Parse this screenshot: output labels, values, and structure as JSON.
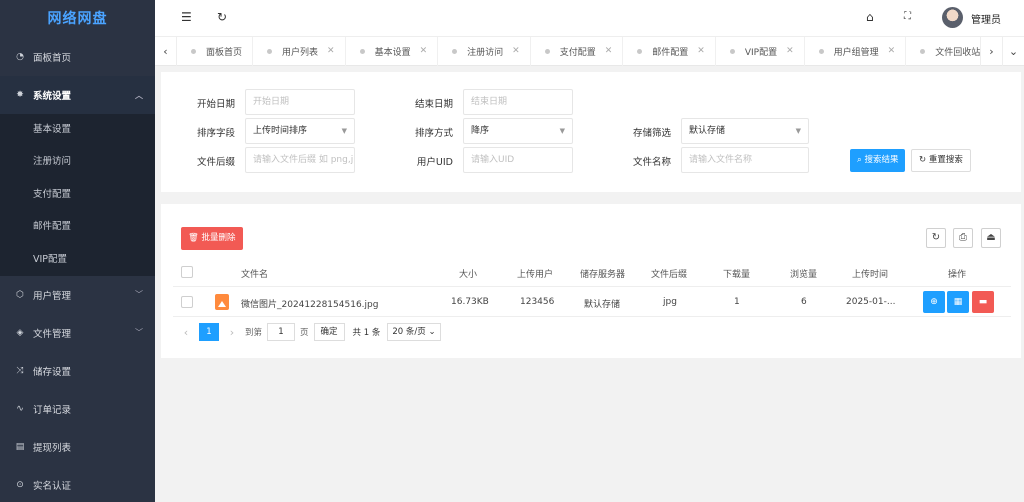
{
  "app": {
    "logo": "网络网盘"
  },
  "sidebar": {
    "items": [
      {
        "label": "面板首页",
        "icon": "dashboard-icon"
      },
      {
        "label": "系统设置",
        "icon": "gear-icon",
        "expanded": true
      },
      {
        "label": "用户管理",
        "icon": "box-icon"
      },
      {
        "label": "文件管理",
        "icon": "layers-icon"
      },
      {
        "label": "储存设置",
        "icon": "shuffle-icon"
      },
      {
        "label": "订单记录",
        "icon": "pulse-icon"
      },
      {
        "label": "提现列表",
        "icon": "list-icon"
      },
      {
        "label": "实名认证",
        "icon": "check-circle-icon"
      }
    ],
    "sub": [
      "基本设置",
      "注册访问",
      "支付配置",
      "邮件配置",
      "VIP配置"
    ]
  },
  "header": {
    "admin": "管理员"
  },
  "tabs": [
    "面板首页",
    "用户列表",
    "基本设置",
    "注册访问",
    "支付配置",
    "邮件配置",
    "VIP配置",
    "用户组管理",
    "文件回收站"
  ],
  "search": {
    "start_date_label": "开始日期",
    "start_date_placeholder": "开始日期",
    "end_date_label": "结束日期",
    "end_date_placeholder": "结束日期",
    "sort_field_label": "排序字段",
    "sort_field_value": "上传时间排序",
    "sort_order_label": "排序方式",
    "sort_order_value": "降序",
    "storage_label": "存储筛选",
    "storage_value": "默认存储",
    "suffix_label": "文件后缀",
    "suffix_placeholder": "请输入文件后缀 如 png,jpg 等",
    "uid_label": "用户UID",
    "uid_placeholder": "请输入UID",
    "name_label": "文件名称",
    "name_placeholder": "请输入文件名称",
    "search_btn": "搜索结果",
    "reset_btn": "重置搜索"
  },
  "table": {
    "batch_delete": "批量删除",
    "columns": [
      "文件名",
      "大小",
      "上传用户",
      "储存服务器",
      "文件后缀",
      "下载量",
      "浏览量",
      "上传时间",
      "操作"
    ],
    "rows": [
      {
        "name": "微信图片_20241228154516.jpg",
        "size": "16.73KB",
        "user": "123456",
        "server": "默认存储",
        "ext": "jpg",
        "downloads": "1",
        "views": "6",
        "time": "2025-01-..."
      }
    ]
  },
  "pager": {
    "current": "1",
    "goto_label": "到第",
    "goto_value": "1",
    "page_unit": "页",
    "confirm": "确定",
    "total": "共 1 条",
    "per_page": "20 条/页"
  },
  "colors": {
    "sidebar": "#2b3343",
    "primary": "#1e9fff",
    "danger": "#f25a54",
    "logo": "#4aa3ff"
  }
}
